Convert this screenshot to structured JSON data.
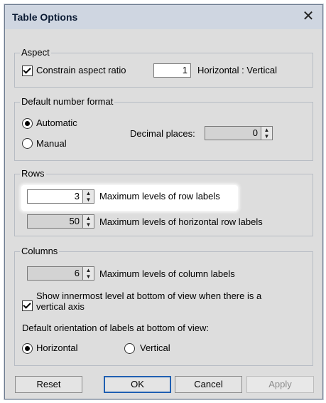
{
  "dialog": {
    "title": "Table Options",
    "close_icon": "close-icon"
  },
  "aspect": {
    "legend": "Aspect",
    "constrain_label": "Constrain aspect ratio",
    "constrain_checked": true,
    "ratio_value": "1",
    "ratio_label": "Horizontal : Vertical"
  },
  "number_format": {
    "legend": "Default number format",
    "automatic_label": "Automatic",
    "manual_label": "Manual",
    "selected": "Automatic",
    "decimal_label": "Decimal places:",
    "decimal_value": "0"
  },
  "rows": {
    "legend": "Rows",
    "row_levels_value": "3",
    "row_levels_label": "Maximum levels of row labels",
    "horizontal_levels_value": "50",
    "horizontal_levels_label": "Maximum levels of horizontal row labels"
  },
  "columns": {
    "legend": "Columns",
    "column_levels_value": "6",
    "column_levels_label": "Maximum levels of column labels",
    "show_innermost_line1": "Show innermost level at bottom of view when there is a",
    "show_innermost_line2": "vertical axis",
    "show_innermost_checked": true,
    "orientation_label": "Default orientation of labels at bottom of view:",
    "horizontal_label": "Horizontal",
    "vertical_label": "Vertical",
    "orientation_selected": "Horizontal"
  },
  "buttons": {
    "reset": "Reset",
    "ok": "OK",
    "cancel": "Cancel",
    "apply": "Apply"
  }
}
